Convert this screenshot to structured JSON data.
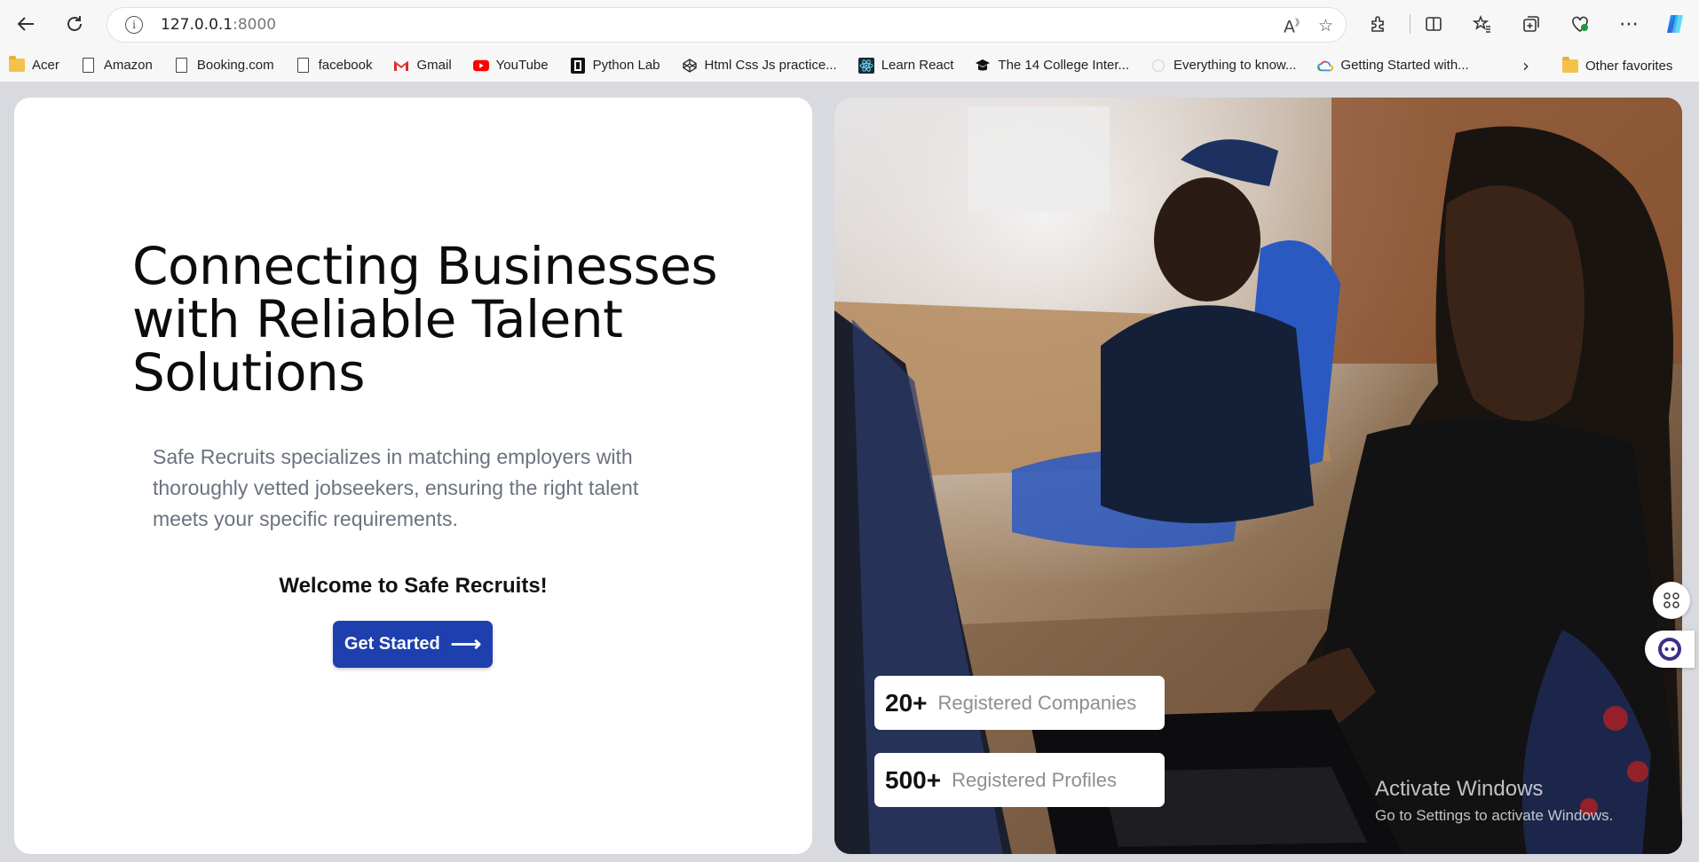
{
  "browser": {
    "url_host": "127.0.0.1",
    "url_port": ":8000",
    "bookmarks": [
      {
        "label": "Acer",
        "icon": "folder-icon"
      },
      {
        "label": "Amazon",
        "icon": "page-icon"
      },
      {
        "label": "Booking.com",
        "icon": "page-icon"
      },
      {
        "label": "facebook",
        "icon": "page-icon"
      },
      {
        "label": "Gmail",
        "icon": "gmail-icon"
      },
      {
        "label": "YouTube",
        "icon": "youtube-icon"
      },
      {
        "label": "Python Lab",
        "icon": "python-lab-icon"
      },
      {
        "label": "Html Css Js practice...",
        "icon": "codepen-icon"
      },
      {
        "label": "Learn React",
        "icon": "react-icon"
      },
      {
        "label": "The 14 College Inter...",
        "icon": "graduation-icon"
      },
      {
        "label": "Everything to know...",
        "icon": "loading-icon"
      },
      {
        "label": "Getting Started with...",
        "icon": "google-cloud-icon"
      }
    ],
    "other_favorites": "Other favorites"
  },
  "hero": {
    "title_line1": "Connecting Businesses",
    "title_line2": "with Reliable Talent",
    "title_line3": "Solutions",
    "description": "Safe Recruits specializes in matching employers with thoroughly vetted jobseekers, ensuring the right talent meets your specific requirements.",
    "welcome": "Welcome to Safe Recruits!",
    "cta_label": "Get Started",
    "cta_arrow": "⟶"
  },
  "stats": [
    {
      "value": "20+",
      "label": "Registered Companies"
    },
    {
      "value": "500+",
      "label": "Registered Profiles"
    }
  ],
  "watermark": {
    "title": "Activate Windows",
    "subtitle": "Go to Settings to activate Windows."
  },
  "colors": {
    "accent": "#1e3fae",
    "page_bg": "#d8dadf"
  }
}
